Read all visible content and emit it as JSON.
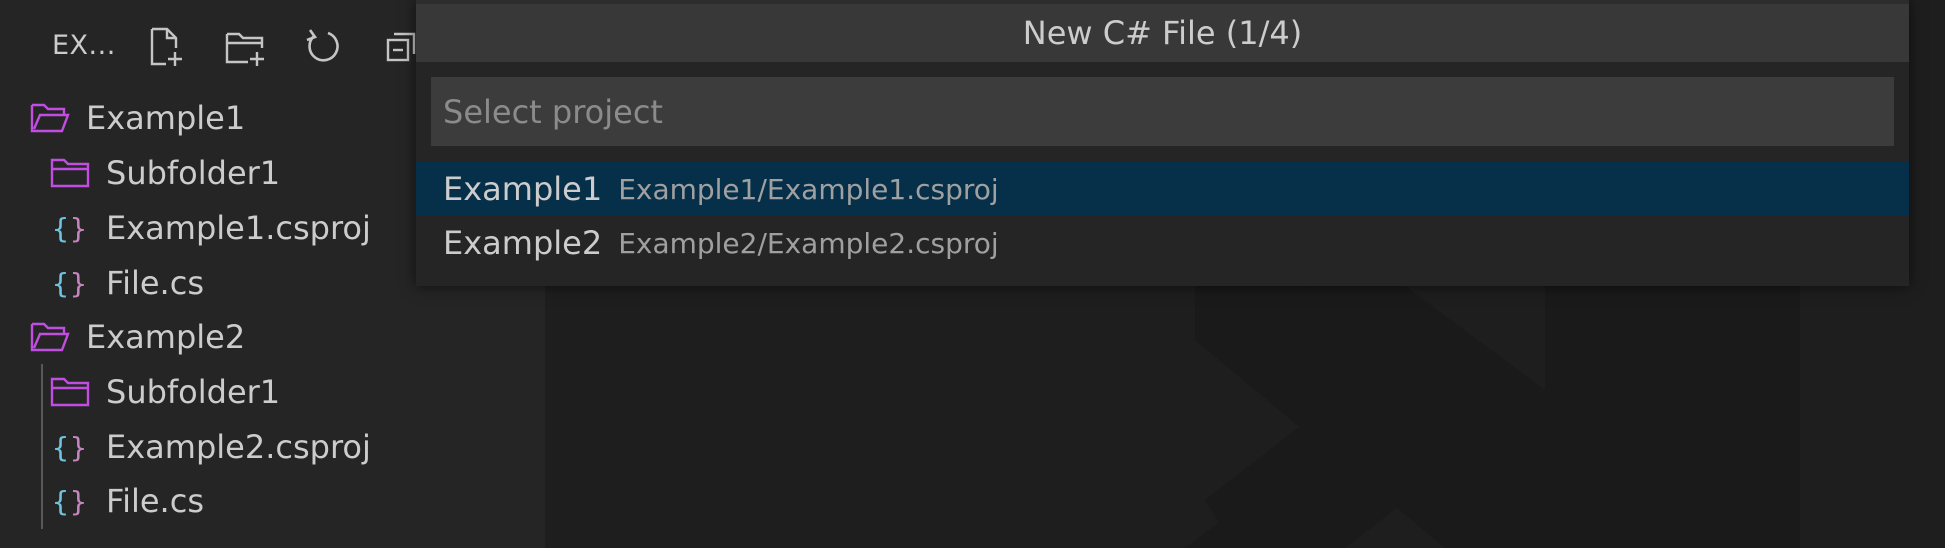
{
  "explorer": {
    "title": "EX...",
    "toolbar": [
      {
        "name": "new-file-icon"
      },
      {
        "name": "new-folder-icon"
      },
      {
        "name": "refresh-icon"
      },
      {
        "name": "collapse-all-icon"
      }
    ],
    "tree": [
      {
        "label": "Example1",
        "icon": "folder-open-icon"
      },
      {
        "label": "Subfolder1",
        "icon": "folder-icon"
      },
      {
        "label": "Example1.csproj",
        "icon": "json-braces-icon"
      },
      {
        "label": "File.cs",
        "icon": "json-braces-icon"
      },
      {
        "label": "Example2",
        "icon": "folder-open-icon"
      },
      {
        "label": "Subfolder1",
        "icon": "folder-icon"
      },
      {
        "label": "Example2.csproj",
        "icon": "json-braces-icon"
      },
      {
        "label": "File.cs",
        "icon": "json-braces-icon"
      }
    ]
  },
  "quick_pick": {
    "title": "New C# File (1/4)",
    "placeholder": "Select project",
    "value": "",
    "items": [
      {
        "label": "Example1",
        "description": "Example1/Example1.csproj",
        "selected": true
      },
      {
        "label": "Example2",
        "description": "Example2/Example2.csproj",
        "selected": false
      }
    ]
  },
  "colors": {
    "folder": "#c14ee0",
    "brace_a": "#6fc3df",
    "brace_b": "#c586c0",
    "selection": "#062f4a",
    "sidebar_bg": "#252526",
    "editor_bg": "#1e1e1e",
    "input_bg": "#3c3c3c"
  }
}
